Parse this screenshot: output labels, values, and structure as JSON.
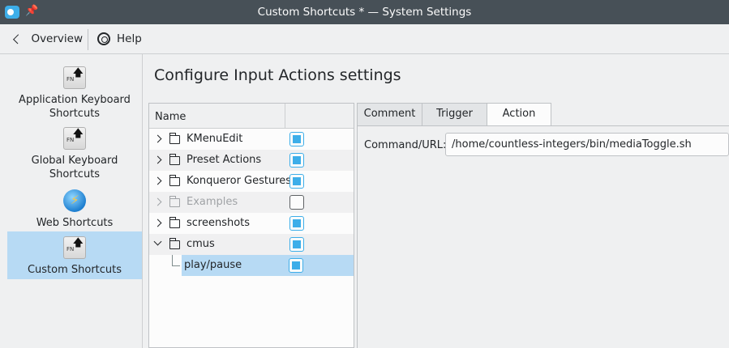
{
  "window": {
    "title": "Custom Shortcuts * — System Settings"
  },
  "toolbar": {
    "overview_label": "Overview",
    "help_label": "Help"
  },
  "sidebar": {
    "items": [
      {
        "label": "Application Keyboard Shortcuts",
        "icon": "fn-key-icon"
      },
      {
        "label": "Global Keyboard Shortcuts",
        "icon": "fn-key-icon"
      },
      {
        "label": "Web Shortcuts",
        "icon": "globe-icon"
      },
      {
        "label": "Custom Shortcuts",
        "icon": "fn-key-icon",
        "selected": true
      }
    ]
  },
  "main": {
    "title": "Configure Input Actions settings",
    "tree": {
      "header": "Name",
      "rows": [
        {
          "label": "KMenuEdit",
          "enabled": true
        },
        {
          "label": "Preset Actions",
          "enabled": true
        },
        {
          "label": "Konqueror Gestures",
          "enabled": true
        },
        {
          "label": "Examples",
          "enabled": false
        },
        {
          "label": "screenshots",
          "enabled": true
        },
        {
          "label": "cmus",
          "enabled": true,
          "expanded": true
        },
        {
          "label": "play/pause",
          "enabled": true,
          "selected": true
        }
      ]
    },
    "tabs": [
      {
        "label": "Comment"
      },
      {
        "label": "Trigger"
      },
      {
        "label": "Action",
        "active": true
      }
    ],
    "action": {
      "command_label": "Command/URL:",
      "command_value": "/home/countless-integers/bin/mediaToggle.sh"
    }
  },
  "colors": {
    "accent": "#3daee9",
    "selection": "#b7daf4",
    "titlebar": "#475057"
  }
}
